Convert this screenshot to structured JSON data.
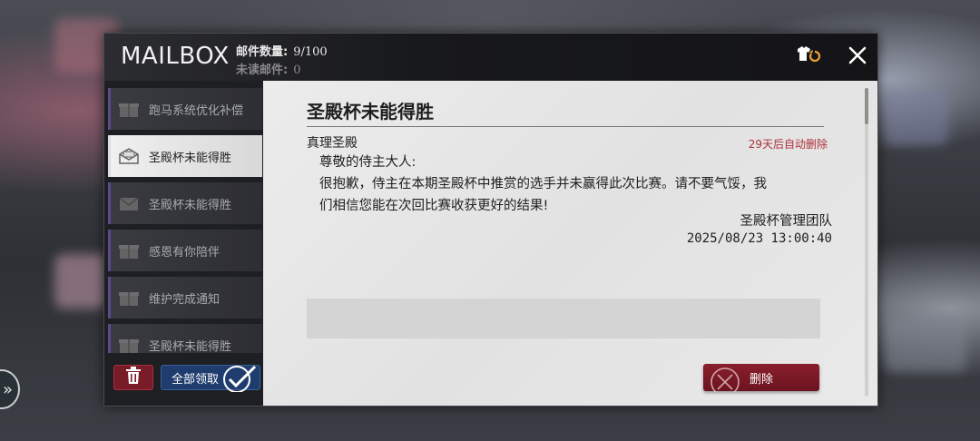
{
  "header": {
    "title": "MAILBOX",
    "mail_count_label": "邮件数量:",
    "mail_count_value": "9/100",
    "unread_label": "未读邮件:",
    "unread_value": "0",
    "outfit_icon": "outfit-swap-icon",
    "close_icon": "close-icon"
  },
  "list": {
    "items": [
      {
        "label": "跑马系统优化补偿",
        "icon": "gift-box-icon"
      },
      {
        "label": "圣殿杯未能得胜",
        "icon": "envelope-open-icon"
      },
      {
        "label": "圣殿杯未能得胜",
        "icon": "envelope-icon"
      },
      {
        "label": "感恩有你陪伴",
        "icon": "gift-box-icon"
      },
      {
        "label": "维护完成通知",
        "icon": "gift-box-icon"
      },
      {
        "label": "圣殿杯未能得胜",
        "icon": "gift-box-icon"
      }
    ],
    "claim_all_label": "全部领取"
  },
  "mail": {
    "title": "圣殿杯未能得胜",
    "sender": "真理圣殿",
    "expire": "29天后自动删除",
    "greeting": "尊敬的侍主大人:",
    "body_line1": "很抱歉，侍主在本期圣殿杯中推赏的选手并未赢得此次比赛。请不要气馁，我",
    "body_line2": "们相信您能在次回比赛收获更好的结果!",
    "signature": "圣殿杯管理团队",
    "date": "2025/08/23 13:00:40",
    "delete_label": "删除"
  },
  "colors": {
    "accent_red": "#7a1c28",
    "accent_blue": "#1e3d6e",
    "expire_red": "#b0303c"
  }
}
